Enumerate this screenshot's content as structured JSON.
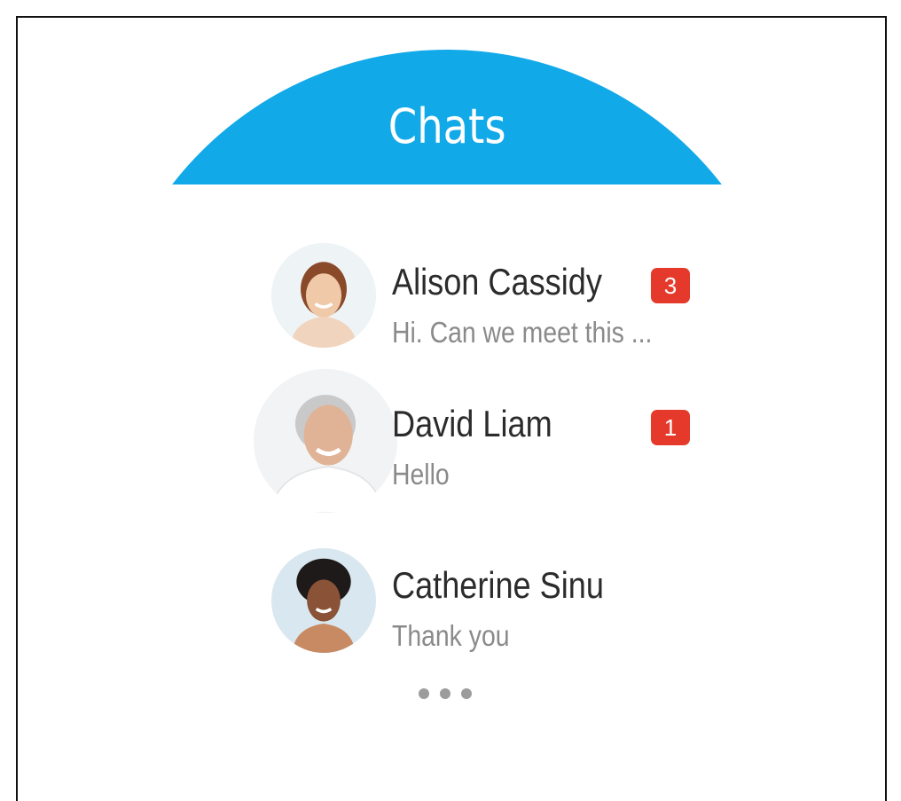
{
  "header": {
    "title": "Chats",
    "color": "#12a9e8"
  },
  "chats": [
    {
      "name": "Alison Cassidy",
      "preview": "Hi. Can we meet this ...",
      "unread": "3"
    },
    {
      "name": "David Liam",
      "preview": "Hello",
      "unread": "1"
    },
    {
      "name": "Catherine Sinu",
      "preview": "Thank you",
      "unread": ""
    }
  ],
  "colors": {
    "badge": "#e53a2b",
    "name_text": "#2b2b2b",
    "preview_text": "#8a8a8a"
  },
  "more_icon": "ellipsis-icon"
}
